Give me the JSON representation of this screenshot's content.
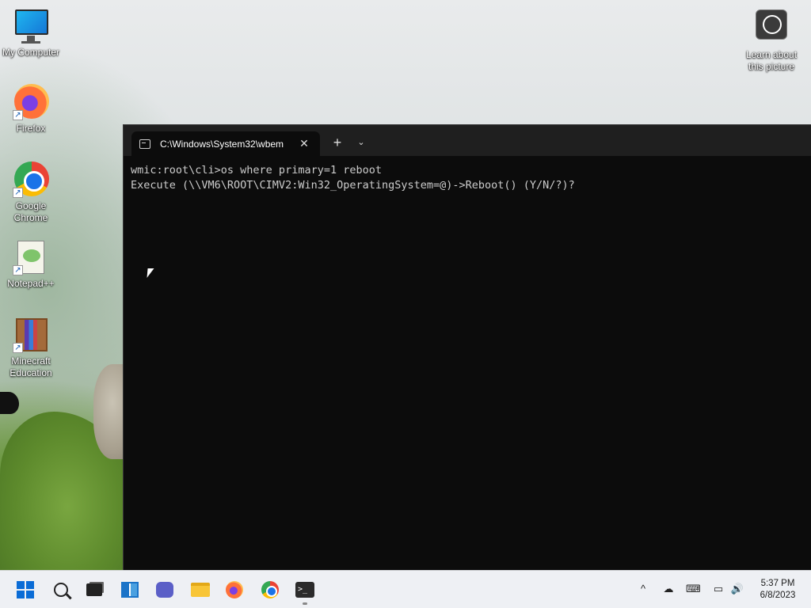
{
  "desktop": {
    "icons": [
      {
        "label": "My Computer",
        "icon": "monitor-icon"
      },
      {
        "label": "Firefox",
        "icon": "firefox-icon"
      },
      {
        "label": "Google Chrome",
        "icon": "chrome-icon"
      },
      {
        "label": "Notepad++",
        "icon": "notepadpp-icon"
      },
      {
        "label": "Minecraft Education",
        "icon": "minecraft-icon"
      }
    ],
    "learn_about": {
      "label": "Learn about this picture",
      "icon": "camera-icon"
    }
  },
  "terminal": {
    "tab_title": "C:\\Windows\\System32\\wbem",
    "close_glyph": "✕",
    "new_tab_glyph": "+",
    "dropdown_glyph": "⌄",
    "lines": [
      "wmic:root\\cli>os where primary=1 reboot",
      "Execute (\\\\VM6\\ROOT\\CIMV2:Win32_OperatingSystem=@)->Reboot() (Y/N/?)?"
    ]
  },
  "taskbar": {
    "items": [
      "start-icon",
      "search-icon",
      "task-view-icon",
      "widgets-icon",
      "chat-icon",
      "file-explorer-icon",
      "firefox-icon",
      "chrome-icon",
      "terminal-icon"
    ],
    "tray": {
      "chevron": "^",
      "time": "5:37 PM",
      "date": "6/8/2023"
    }
  }
}
